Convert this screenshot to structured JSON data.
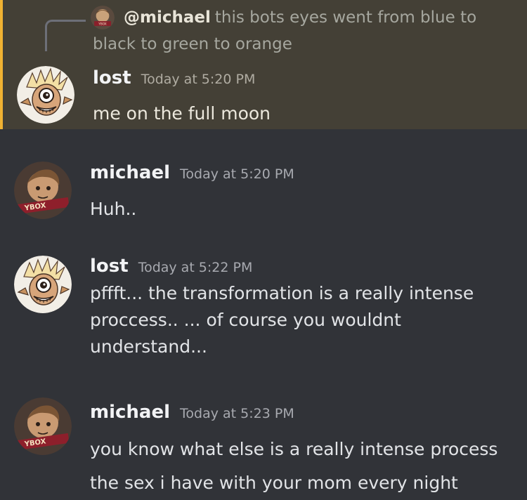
{
  "reply": {
    "username": "@michael",
    "text": "this bots eyes went from blue to black to green to orange"
  },
  "messages": [
    {
      "username": "lost",
      "timestamp": "Today at 5:20 PM",
      "lines": [
        "me on the full moon"
      ],
      "avatar": "lost-avatar",
      "highlighted": true
    },
    {
      "username": "michael",
      "timestamp": "Today at 5:20 PM",
      "lines": [
        "Huh.."
      ],
      "avatar": "michael-avatar",
      "highlighted": false
    },
    {
      "username": "lost",
      "timestamp": "Today at 5:22 PM",
      "lines": [
        "pffft... the transformation is a really intense",
        "proccess.. ... of course you wouldnt",
        "understand..."
      ],
      "avatar": "lost-avatar",
      "highlighted": false
    },
    {
      "username": "michael",
      "timestamp": "Today at 5:23 PM",
      "lines": [
        "you know what else is a really intense process",
        "the sex i have with your mom every night"
      ],
      "avatar": "michael-avatar",
      "highlighted": false
    }
  ],
  "avatar_text": {
    "michael_badge": "YBOX"
  },
  "colors": {
    "background": "#313338",
    "highlight_background": "#444036",
    "highlight_border": "#f0b232",
    "username": "#f2f3f5",
    "timestamp": "#a8aab0"
  }
}
